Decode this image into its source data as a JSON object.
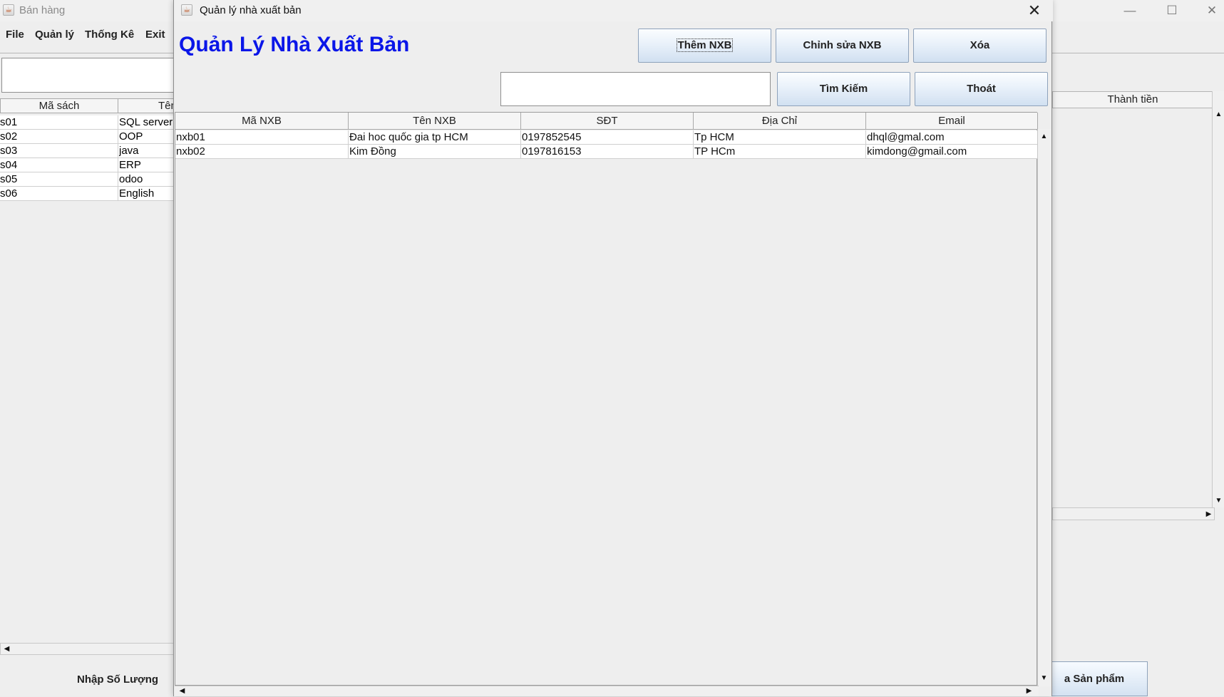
{
  "background_window": {
    "title": "Bán hàng",
    "menu": [
      "File",
      "Quản lý",
      "Thống Kê",
      "Exit"
    ],
    "table": {
      "headers": [
        "Mã sách",
        "Tên"
      ],
      "rows": [
        [
          "s01",
          "SQL server"
        ],
        [
          "s02",
          "OOP"
        ],
        [
          "s03",
          "java"
        ],
        [
          "s04",
          "ERP"
        ],
        [
          "s05",
          "odoo"
        ],
        [
          "s06",
          "English"
        ]
      ]
    },
    "quantity_label": "Nhập Số Lượng",
    "right_table_header": "Thành tiền",
    "right_button_label": "a Sản phẩm",
    "window_controls": {
      "minimize": "—",
      "maximize": "☐",
      "close": "✕"
    }
  },
  "dialog": {
    "title": "Quản lý nhà xuất bản",
    "close_glyph": "✕",
    "heading": "Quản Lý Nhà Xuất Bản",
    "heading_color": "#0a16e8",
    "buttons": {
      "add": "Thêm NXB",
      "edit": "Chỉnh sửa NXB",
      "delete": "Xóa",
      "search": "Tìm Kiếm",
      "exit": "Thoát"
    },
    "search": {
      "value": ""
    },
    "table": {
      "headers": [
        "Mã NXB",
        "Tên NXB",
        "SĐT",
        "Địa Chỉ",
        "Email"
      ],
      "rows": [
        [
          "nxb01",
          "Đai hoc quốc gia tp HCM",
          "0197852545",
          "Tp HCM",
          "dhql@gmal.com"
        ],
        [
          "nxb02",
          "Kim Đồng",
          "0197816153",
          "TP HCm",
          "kimdong@gmail.com"
        ]
      ]
    }
  }
}
